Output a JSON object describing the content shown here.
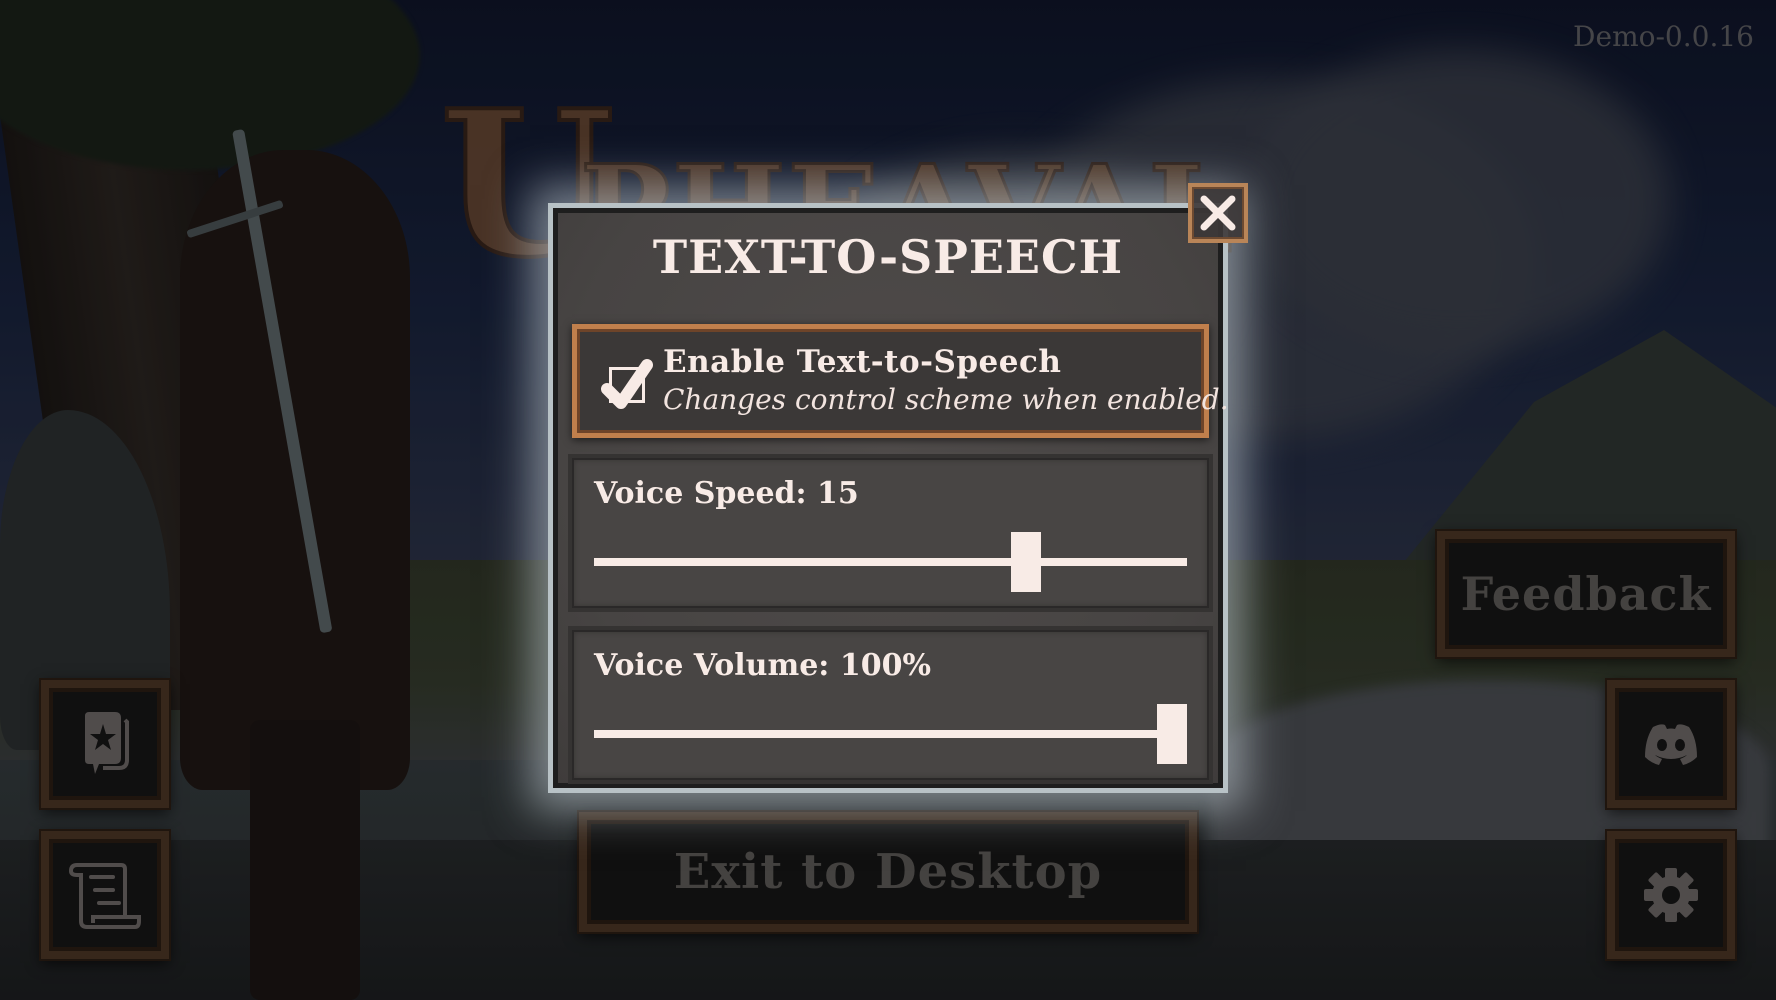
{
  "version_label": "Demo-0.0.16",
  "logo": {
    "first_letter": "U",
    "rest": "PHEAVAL"
  },
  "modal": {
    "title": "TEXT-TO-SPEECH",
    "close_icon": "close-x-icon",
    "enable_tts": {
      "label": "Enable Text-to-Speech",
      "description": "Changes control scheme when enabled.",
      "checked": true
    },
    "voice_speed": {
      "label": "Voice Speed: 15",
      "value": 15,
      "fraction": 0.74
    },
    "voice_volume": {
      "label": "Voice Volume: 100%",
      "value": 100,
      "fraction": 1.0
    }
  },
  "buttons": {
    "exit": "Exit to Desktop",
    "feedback": "Feedback",
    "journal_icon": "star-journal-icon",
    "notes_icon": "scroll-icon",
    "discord_icon": "discord-icon",
    "settings_icon": "gear-icon"
  },
  "colors": {
    "text_light": "#f8ebe6",
    "panel": "#484544",
    "accent_copper": "#c07f4c",
    "frame_wood": "#4a3424",
    "button_text": "#5b5856"
  }
}
